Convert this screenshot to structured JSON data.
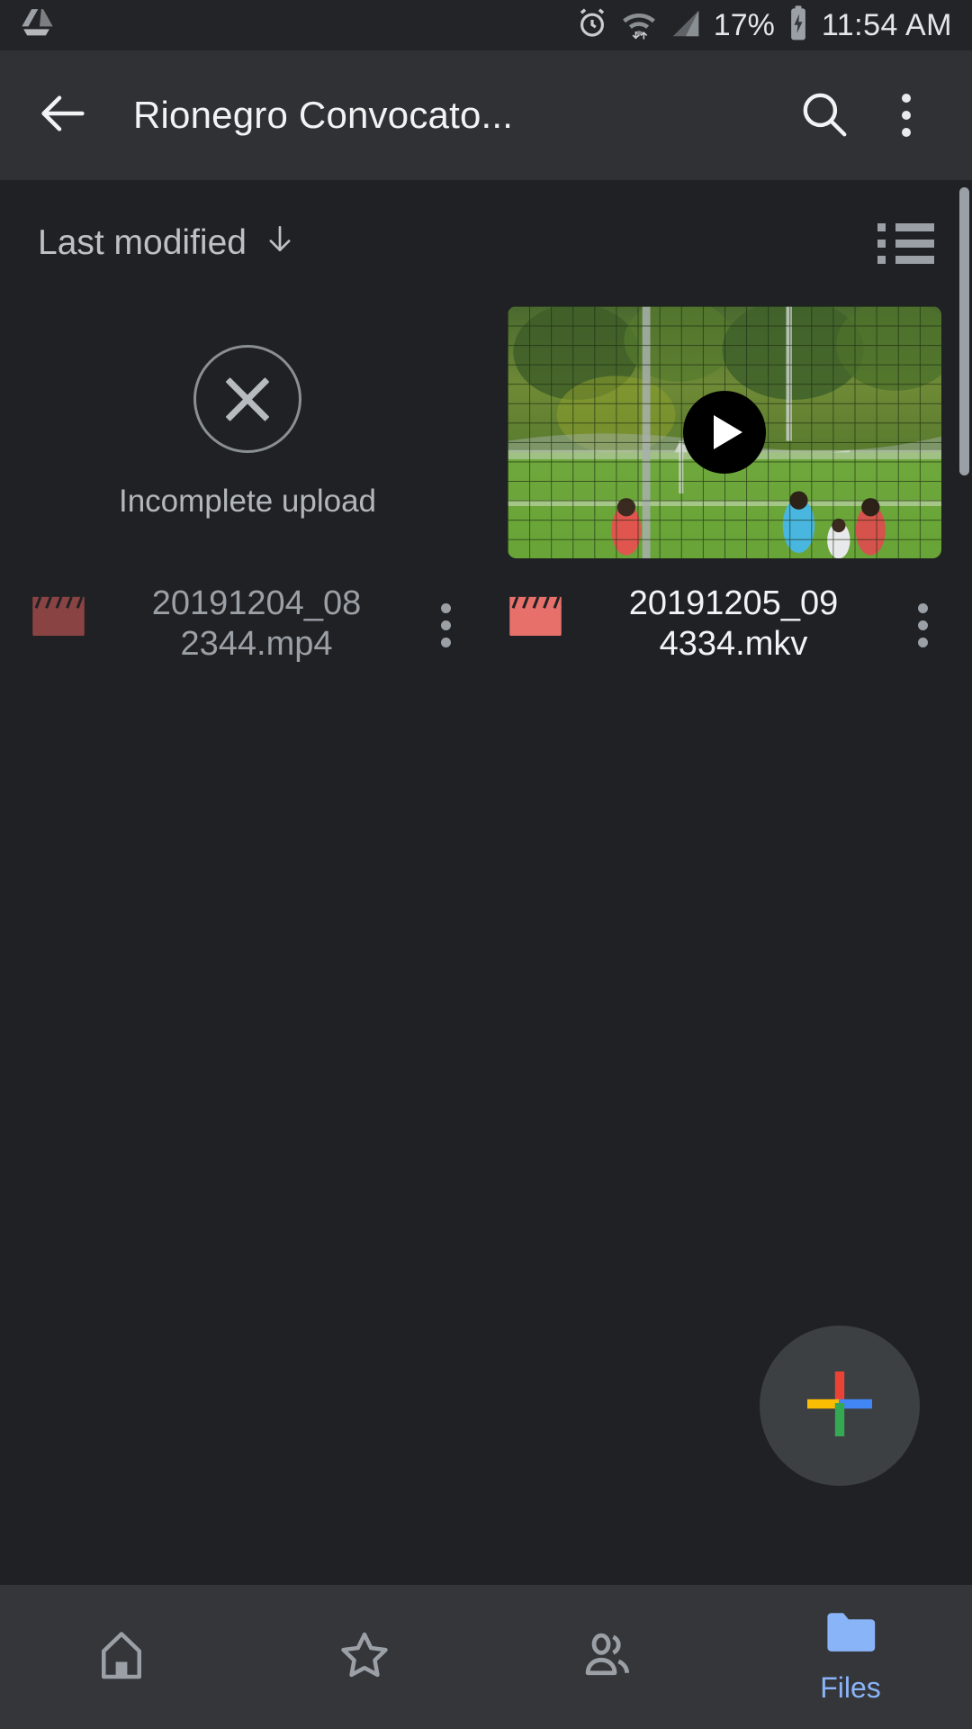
{
  "status_bar": {
    "app_icon": "google-drive-icon",
    "icons": [
      "alarm-icon",
      "wifi-icon",
      "cellular-signal-icon",
      "battery-charging-icon"
    ],
    "battery_percent": "17%",
    "time": "11:54 AM"
  },
  "app_bar": {
    "back_icon": "back-arrow-icon",
    "title": "Rionegro Convocato...",
    "search_icon": "search-icon",
    "overflow_icon": "more-vert-icon"
  },
  "toolbar": {
    "sort_label": "Last modified",
    "sort_direction_icon": "arrow-down-icon",
    "view_toggle_icon": "list-view-icon"
  },
  "files": [
    {
      "name": "20191204_08\n2344.mp4",
      "name_line1": "20191204_08",
      "name_line2": "2344.mp4",
      "status": "Incomplete upload",
      "thumb_type": "incomplete",
      "thumb_icon": "x-circle-icon",
      "type_icon": "movie-clapperboard-icon",
      "type_icon_color": "#8a4343",
      "name_color": "#9aa0a6",
      "menu_icon": "more-vert-icon"
    },
    {
      "name": "20191205_09\n4334.mkv",
      "name_line1": "20191205_09",
      "name_line2": "4334.mkv",
      "status": "",
      "thumb_type": "video",
      "thumb_icon": "play-button-icon",
      "type_icon": "movie-clapperboard-icon",
      "type_icon_color": "#e8706a",
      "name_color": "#f1f3f4",
      "menu_icon": "more-vert-icon"
    }
  ],
  "fab": {
    "icon": "google-plus-add-icon",
    "colors": {
      "red": "#ea4335",
      "yellow": "#fbbc04",
      "blue": "#4285f4",
      "green": "#34a853"
    }
  },
  "bottom_nav": {
    "items": [
      {
        "icon": "home-icon",
        "label": "",
        "active": false
      },
      {
        "icon": "star-icon",
        "label": "",
        "active": false
      },
      {
        "icon": "people-icon",
        "label": "",
        "active": false
      },
      {
        "icon": "folder-icon",
        "label": "Files",
        "active": true
      }
    ]
  },
  "colors": {
    "background": "#202124",
    "appbar": "#303134",
    "statusbar": "#232427",
    "bottomnav": "#35363a",
    "accent": "#8ab4f8",
    "muted_text": "#9aa0a6"
  }
}
